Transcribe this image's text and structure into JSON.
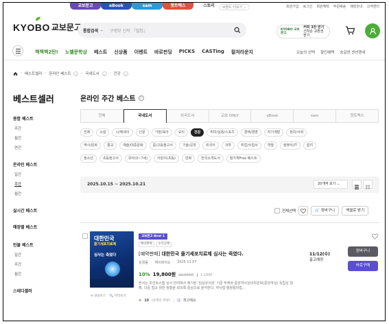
{
  "brand_tabs": [
    {
      "label": "교보문고",
      "color": "#6a4bb5"
    },
    {
      "label": "eBook",
      "color": "#2456b5"
    },
    {
      "label": "sam",
      "color": "#2d9ad8"
    },
    {
      "label": "핫트랙스",
      "color": "#e0523d"
    },
    {
      "label": "스토리",
      "color": "#ffffff"
    }
  ],
  "top_link_extra": "브랜드 더보기 ⌄",
  "top_nav": [
    "회원가입",
    "로그인",
    "회원혜택",
    "주문배송",
    "매장안내",
    "고객센터"
  ],
  "header": {
    "logo_en": "KYOBO",
    "logo_ko": "교보문고",
    "search_category": "통합검색",
    "search_placeholder": "구병모 신작 『절창』",
    "promo_logo": "KYOBO 교보문고",
    "promo_text_1": "커피 3잔 받기",
    "promo_text_2": "선착순 교환권 받기"
  },
  "gnb": {
    "items": [
      "책책책2탄!",
      "노벨문학상",
      "베스트",
      "신상품",
      "이벤트",
      "바로펀딩",
      "PICKS",
      "CASTing",
      "컬처라운지"
    ],
    "green": [
      0,
      1
    ],
    "right": [
      "오늘의 선택",
      "할인혜택",
      "송길영 센션렌세"
    ]
  },
  "breadcrumb": [
    "베스트셀러",
    "온라인 베스트",
    "국내도서",
    "건강"
  ],
  "sidebar": {
    "title": "베스트셀러",
    "sections": [
      {
        "label": "종합 베스트",
        "items": [
          "주간",
          "월간",
          "연간"
        ]
      },
      {
        "label": "온라인 베스트",
        "items": [
          "일간",
          "주간",
          "월간"
        ]
      },
      {
        "label": "실시간 베스트",
        "items": []
      },
      {
        "label": "매장별 베스트",
        "items": []
      },
      {
        "label": "인물 베스트",
        "items": [
          "일간",
          "주간",
          "월간"
        ]
      },
      {
        "label": "스테디셀러",
        "items": []
      }
    ]
  },
  "main": {
    "title": "온라인 주간 베스트",
    "tabs": [
      "전체",
      "국내도서",
      "외국도서",
      "교보 ONLY",
      "eBook",
      "sam",
      "핫트랙스"
    ],
    "active_tab": 1,
    "chips": [
      [
        "전체",
        "소설",
        "시/에세이",
        "인문",
        "가정/육아",
        "요리",
        "건강",
        "취미/실용/스포츠",
        "경제/경영",
        "자기계발",
        "정치/사회"
      ],
      [
        "역사/문화",
        "종교",
        "예술/대중문화",
        "중/고등참고서",
        "기술/공학",
        "외국어",
        "과학",
        "취업/수험서",
        "여행",
        "컴퓨터/IT",
        "잡지"
      ],
      [
        "청소년",
        "초등참고서",
        "유아(0~7세)",
        "어린이(초등)",
        "만화",
        "한국소개도서",
        "참가책Free 베스트"
      ]
    ],
    "active_chip": "건강",
    "date_range": "2025.10.15 ~ 2025.10.21",
    "sort_select": "20개씩 보기 ⌄",
    "select_all": "전체선택",
    "btn_cart": "장바구니",
    "btn_excel": "엑셀로 받기"
  },
  "product": {
    "cover_title": "대한민국",
    "cover_sub_1": "줄기세포치료제",
    "cover_sub_2": "심사는 축였다",
    "badge": "교보문고 Best 1",
    "tags": [
      "예약판매",
      "소득공제"
    ],
    "title_prefix": "[예약판매]",
    "title_main": "대한민국 줄기세포치료제 심사는 죽였다.",
    "author": "김경음",
    "publisher": "케이바이오",
    "date": "2025.11.07",
    "discount": "10%",
    "price": "19,800원",
    "original_price": "22,000원",
    "points": "1,100P",
    "description": "본서는 조인트스텝 심사 반려에서 제기된 '임상유의성' 기준 부재와 중앙약사심의위원회(중앙약심) 독립성 침해, 다중 법규 위반 정황을 회의록 중심으로 분석한다. 약사법·행정절차법...",
    "review_score": "10",
    "review_count": "(9개의 리뷰)",
    "review_label": "최고예요",
    "preview_link": "미리보기",
    "cover_link": "내용보기",
    "delivery_date": "11/12(수)",
    "delivery_label": "출고예정",
    "btn_cart": "장바구니",
    "btn_buy": "바로구매"
  }
}
